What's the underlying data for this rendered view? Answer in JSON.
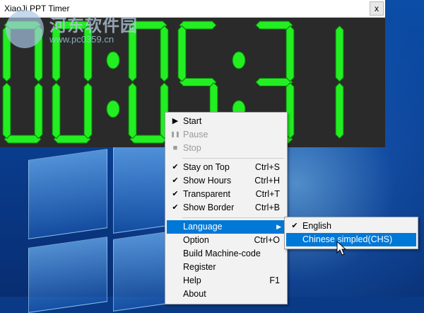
{
  "app": {
    "title": "XiaoJi PPT Timer",
    "close_label": "x"
  },
  "timer": {
    "display": "00:05:31"
  },
  "watermark": {
    "site_name": "河东软件园",
    "url": "www.pc0359.cn"
  },
  "colors": {
    "digit": "#22ee22",
    "digit_stroke": "#0a7a0a",
    "highlight": "#0078d7",
    "menu_bg": "#f2f2f2"
  },
  "menu": {
    "start": {
      "label": "Start"
    },
    "pause": {
      "label": "Pause"
    },
    "stop": {
      "label": "Stop"
    },
    "stay_on_top": {
      "label": "Stay on Top",
      "shortcut": "Ctrl+S"
    },
    "show_hours": {
      "label": "Show Hours",
      "shortcut": "Ctrl+H"
    },
    "transparent": {
      "label": "Transparent",
      "shortcut": "Ctrl+T"
    },
    "show_border": {
      "label": "Show Border",
      "shortcut": "Ctrl+B"
    },
    "language": {
      "label": "Language"
    },
    "option": {
      "label": "Option",
      "shortcut": "Ctrl+O"
    },
    "build": {
      "label": "Build Machine-code"
    },
    "register": {
      "label": "Register"
    },
    "help": {
      "label": "Help",
      "shortcut": "F1"
    },
    "about": {
      "label": "About"
    }
  },
  "submenu": {
    "english": {
      "label": "English"
    },
    "chinese": {
      "label": "Chinese simpled(CHS)"
    }
  },
  "icons": {
    "check": "✔",
    "play": "▶",
    "pause": "❚❚",
    "stop": "■",
    "submenu_arrow": "▶"
  }
}
